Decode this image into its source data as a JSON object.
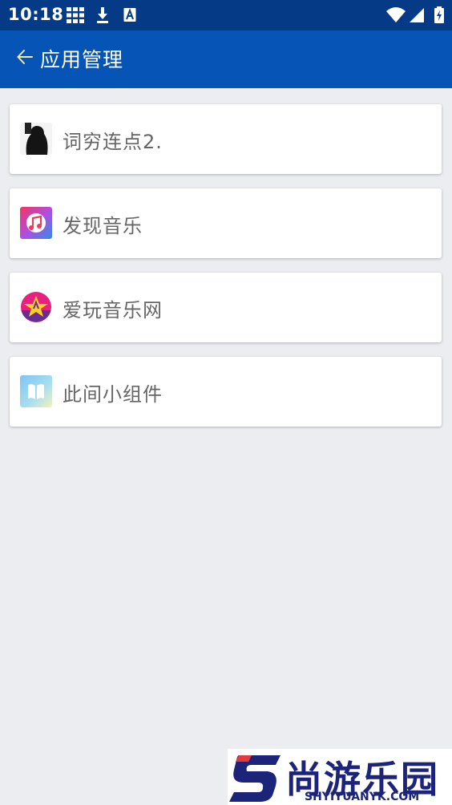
{
  "status_bar": {
    "time": "10:18",
    "icons": [
      "grid-icon",
      "download-icon",
      "font-icon",
      "wifi-icon",
      "signal-icon",
      "battery-charging-icon"
    ]
  },
  "app_bar": {
    "back_icon": "arrow-left-icon",
    "title": "应用管理",
    "accent_color": "#0655b6",
    "status_color": "#053a87"
  },
  "apps": [
    {
      "label": "词穷连点2.",
      "icon": "dark-portrait-app-icon"
    },
    {
      "label": "发现音乐",
      "icon": "music-note-app-icon"
    },
    {
      "label": "爱玩音乐网",
      "icon": "star-circle-app-icon"
    },
    {
      "label": "此间小组件",
      "icon": "book-widget-app-icon"
    }
  ],
  "watermark": {
    "text_cn": "尚游乐园",
    "text_en": "SHYIYUANYK.COM",
    "logo_icon": "s-logo-icon"
  }
}
